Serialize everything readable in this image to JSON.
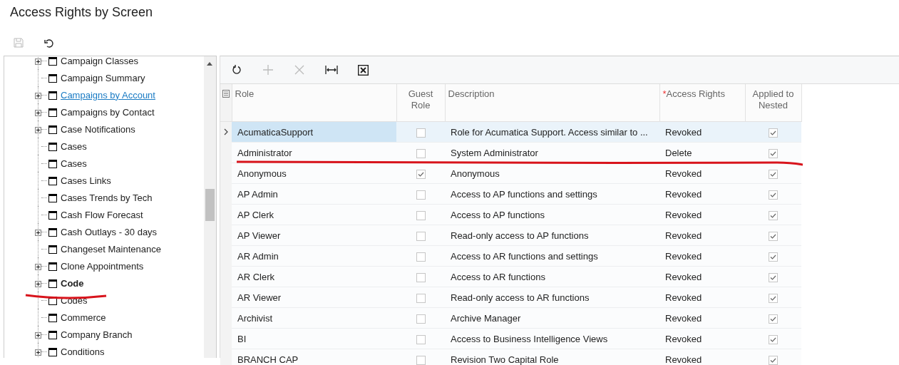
{
  "page": {
    "title": "Access Rights by Screen"
  },
  "tree": {
    "items": [
      {
        "label": "Campaign Classes",
        "expandable": true,
        "selected": false,
        "hovered": false
      },
      {
        "label": "Campaign Summary",
        "expandable": false,
        "selected": false,
        "hovered": false
      },
      {
        "label": "Campaigns by Account",
        "expandable": true,
        "selected": false,
        "hovered": true
      },
      {
        "label": "Campaigns by Contact",
        "expandable": true,
        "selected": false,
        "hovered": false
      },
      {
        "label": "Case Notifications",
        "expandable": true,
        "selected": false,
        "hovered": false
      },
      {
        "label": "Cases",
        "expandable": false,
        "selected": false,
        "hovered": false
      },
      {
        "label": "Cases",
        "expandable": false,
        "selected": false,
        "hovered": false
      },
      {
        "label": "Cases Links",
        "expandable": false,
        "selected": false,
        "hovered": false
      },
      {
        "label": "Cases Trends by Tech",
        "expandable": false,
        "selected": false,
        "hovered": false
      },
      {
        "label": "Cash Flow Forecast",
        "expandable": false,
        "selected": false,
        "hovered": false
      },
      {
        "label": "Cash Outlays - 30 days",
        "expandable": true,
        "selected": false,
        "hovered": false
      },
      {
        "label": "Changeset Maintenance",
        "expandable": false,
        "selected": false,
        "hovered": false
      },
      {
        "label": "Clone Appointments",
        "expandable": true,
        "selected": false,
        "hovered": false
      },
      {
        "label": "Code",
        "expandable": true,
        "selected": true,
        "hovered": false
      },
      {
        "label": "Codes",
        "expandable": false,
        "selected": false,
        "hovered": false
      },
      {
        "label": "Commerce",
        "expandable": false,
        "selected": false,
        "hovered": false
      },
      {
        "label": "Company Branch",
        "expandable": true,
        "selected": false,
        "hovered": false
      },
      {
        "label": "Conditions",
        "expandable": true,
        "selected": false,
        "hovered": false
      }
    ]
  },
  "grid": {
    "toolbar": [
      {
        "kind": "refresh",
        "disabled": false
      },
      {
        "kind": "add",
        "disabled": true
      },
      {
        "kind": "delete",
        "disabled": true
      },
      {
        "kind": "fit",
        "disabled": false
      },
      {
        "kind": "excel",
        "disabled": false
      }
    ],
    "columns": [
      {
        "label": "Role"
      },
      {
        "label": "Guest Role"
      },
      {
        "label": "Description"
      },
      {
        "label": "Access Rights",
        "required_mark": "*"
      },
      {
        "label": "Applied to Nested"
      }
    ],
    "rows": [
      {
        "role": "AcumaticaSupport",
        "guest": false,
        "description": "Role for Acumatica Support. Access similar to ...",
        "rights": "Revoked",
        "nested": true,
        "selected": true
      },
      {
        "role": "Administrator",
        "guest": false,
        "description": "System Administrator",
        "rights": "Delete",
        "nested": true,
        "selected": false
      },
      {
        "role": "Anonymous",
        "guest": true,
        "description": "Anonymous",
        "rights": "Revoked",
        "nested": true,
        "selected": false
      },
      {
        "role": "AP Admin",
        "guest": false,
        "description": "Access to AP functions and settings",
        "rights": "Revoked",
        "nested": true,
        "selected": false
      },
      {
        "role": "AP Clerk",
        "guest": false,
        "description": "Access to AP functions",
        "rights": "Revoked",
        "nested": true,
        "selected": false
      },
      {
        "role": "AP Viewer",
        "guest": false,
        "description": "Read-only access to AP functions",
        "rights": "Revoked",
        "nested": true,
        "selected": false
      },
      {
        "role": "AR Admin",
        "guest": false,
        "description": "Access to AR functions and settings",
        "rights": "Revoked",
        "nested": true,
        "selected": false
      },
      {
        "role": "AR Clerk",
        "guest": false,
        "description": "Access to AR functions",
        "rights": "Revoked",
        "nested": true,
        "selected": false
      },
      {
        "role": "AR Viewer",
        "guest": false,
        "description": "Read-only access to AR functions",
        "rights": "Revoked",
        "nested": true,
        "selected": false
      },
      {
        "role": "Archivist",
        "guest": false,
        "description": "Archive Manager",
        "rights": "Revoked",
        "nested": true,
        "selected": false
      },
      {
        "role": "BI",
        "guest": false,
        "description": "Access to Business Intelligence Views",
        "rights": "Revoked",
        "nested": true,
        "selected": false
      },
      {
        "role": "BRANCH CAP",
        "guest": false,
        "description": "Revision Two Capital Role",
        "rights": "Revoked",
        "nested": true,
        "selected": false
      }
    ]
  }
}
